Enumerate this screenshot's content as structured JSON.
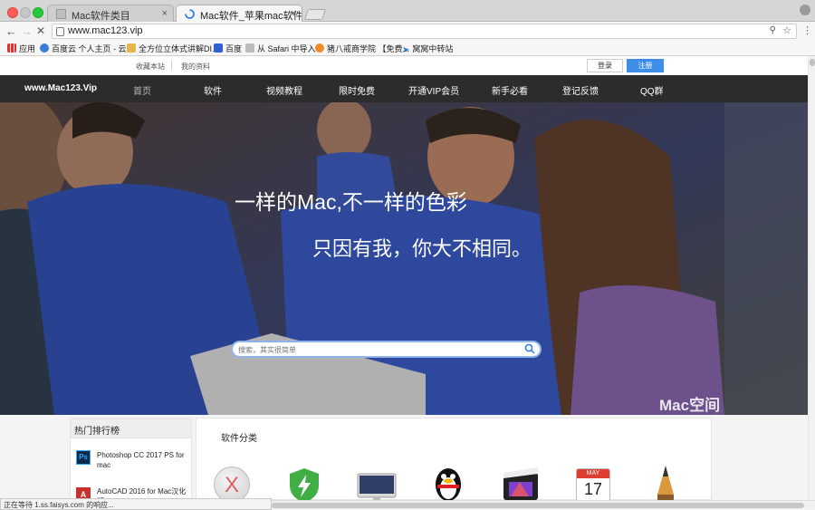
{
  "browser": {
    "tabs": [
      {
        "title": "Mac软件类目",
        "close": "×"
      },
      {
        "title": "Mac软件_苹果mac软件下载_Mac",
        "close": "×"
      }
    ],
    "url": "www.mac123.vip",
    "bookmarks": [
      {
        "label": "应用",
        "icon": "apps-grid-icon"
      },
      {
        "label": "百度云 个人主页 - 云...",
        "icon": "baidu-cloud-icon"
      },
      {
        "label": "全方位立体式讲解DI...",
        "icon": "bookmark-page-icon"
      },
      {
        "label": "百度",
        "icon": "baidu-icon"
      },
      {
        "label": "从 Safari 中导入",
        "icon": "folder-icon"
      },
      {
        "label": "猪八戒商学院 【免费...",
        "icon": "zbj-icon"
      },
      {
        "label": "窝窝中转站",
        "icon": "send-icon"
      }
    ],
    "status": "正在等待 1.ss.faisys.com 的响应..."
  },
  "site": {
    "top_links": [
      "收藏本站",
      "我的资料"
    ],
    "login": "登录",
    "register": "注册",
    "logo": "www.Mac123.Vip",
    "nav": [
      "首页",
      "软件",
      "视频教程",
      "限时免费",
      "开通VIP会员",
      "新手必看",
      "登记反馈",
      "QQ群"
    ],
    "hero": {
      "line1": "一样的Mac,不一样的色彩",
      "line2": "只因有我，你大不相同。",
      "search_placeholder": "搜索，其实很简单",
      "watermark": "Mac空间"
    },
    "ranking": {
      "title": "热门排行榜",
      "items": [
        {
          "name": "Photoshop CC 2017 PS for mac",
          "icon": "photoshop-icon",
          "icon_text": "Ps"
        },
        {
          "name": "AutoCAD 2016 for Mac汉化版",
          "icon": "autocad-icon",
          "icon_text": "A"
        }
      ]
    },
    "categories": {
      "title": "软件分类",
      "icons": [
        "macos-icon",
        "power-icon",
        "imac-icon",
        "qq-penguin-icon",
        "final-cut-icon",
        "calendar-icon",
        "pencil-icon"
      ],
      "calendar_month": "MAY",
      "calendar_day": "17"
    }
  },
  "colors": {
    "nav_bg": "#2c2c2c",
    "register_btn": "#3d8ee6",
    "page_bg": "#f4f4f4"
  }
}
